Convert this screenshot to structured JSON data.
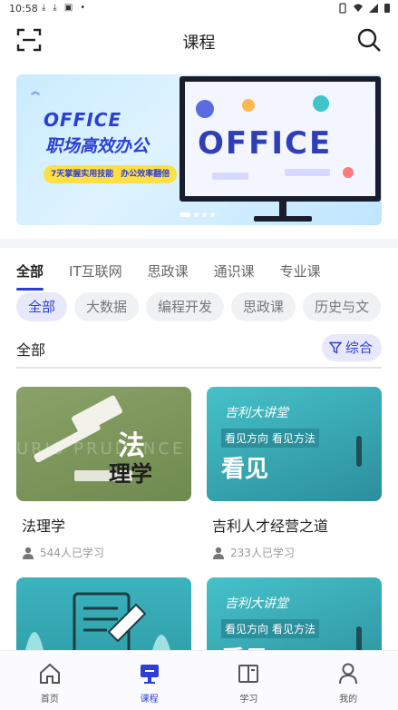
{
  "status_bar": {
    "time": "10:58",
    "notifications": [
      "⤓",
      "⤓",
      "▣",
      "•"
    ]
  },
  "topbar": {
    "title": "课程",
    "scan_icon": "scan-icon",
    "search_icon": "search-icon"
  },
  "banner": {
    "brand": "OFFICE",
    "tagline": "职场高效办公",
    "sub_left": "7天掌握实用技能",
    "sub_right": "办公效率翻倍",
    "screen_word": "OFFICE",
    "slide_count": 4,
    "active_slide": 1
  },
  "category_tabs": [
    {
      "label": "全部",
      "active": true
    },
    {
      "label": "IT互联网",
      "active": false
    },
    {
      "label": "思政课",
      "active": false
    },
    {
      "label": "通识课",
      "active": false
    },
    {
      "label": "专业课",
      "active": false
    }
  ],
  "sub_chips": [
    {
      "label": "全部",
      "active": true
    },
    {
      "label": "大数据",
      "active": false
    },
    {
      "label": "编程开发",
      "active": false
    },
    {
      "label": "思政课",
      "active": false
    },
    {
      "label": "历史与文",
      "active": false
    }
  ],
  "filter": {
    "label": "全部",
    "sort_label": "综合"
  },
  "courses": [
    {
      "name": "法理学",
      "learners": "544人已学习",
      "thumb": {
        "fa": "法",
        "li": "理学",
        "bg_text": "URIS PRUDENCE"
      }
    },
    {
      "name": "吉利人才经营之道",
      "learners": "233人已学习",
      "thumb": {
        "t1": "吉利大讲堂",
        "t2": "看见方向 看见方法",
        "t3": "看见"
      }
    },
    {
      "name": "",
      "learners": "",
      "thumb": {}
    },
    {
      "name": "",
      "learners": "",
      "thumb": {
        "t1": "吉利大讲堂",
        "t2": "看见方向 看见方法",
        "t3": "看见"
      }
    }
  ],
  "bottom_nav": [
    {
      "label": "首页",
      "icon": "home-icon",
      "active": false
    },
    {
      "label": "课程",
      "icon": "course-icon",
      "active": true
    },
    {
      "label": "学习",
      "icon": "study-icon",
      "active": false
    },
    {
      "label": "我的",
      "icon": "profile-icon",
      "active": false
    }
  ],
  "colors": {
    "accent": "#2b3fd6",
    "chip_active_bg": "#e7e9fb",
    "chip_bg": "#f0f1f3"
  }
}
